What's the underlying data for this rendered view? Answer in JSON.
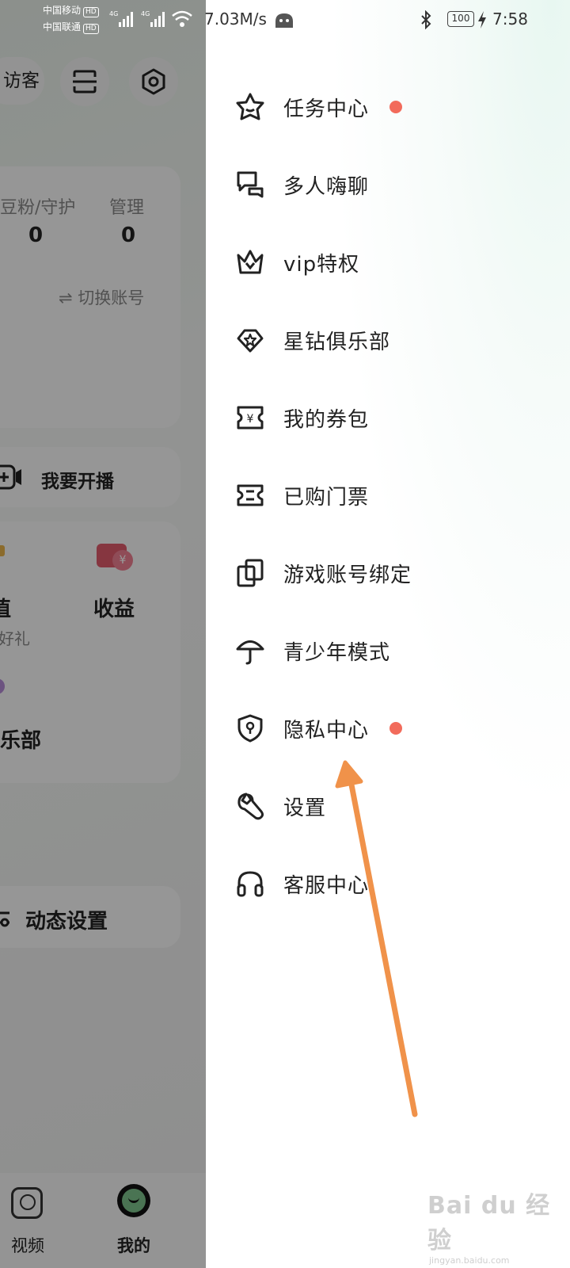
{
  "status_bar": {
    "carrier1": "中国移动",
    "carrier2": "中国联通",
    "hd": "HD",
    "net": "4G",
    "speed": "7.03M/s",
    "battery": "100",
    "time": "7:58"
  },
  "background_page": {
    "visitor_label": "访客",
    "stats": [
      {
        "label": "豆粉/守护",
        "value": "0"
      },
      {
        "label": "管理",
        "value": "0"
      }
    ],
    "switch_account": "⇌ 切换账号",
    "go_live": "我要开播",
    "recharge_title": "值",
    "recharge_sub": "好礼",
    "earnings": "收益",
    "club": "乐部",
    "dynamic_settings": "动态设置",
    "tabs": [
      {
        "label": "视频"
      },
      {
        "label": "我的"
      }
    ]
  },
  "drawer": {
    "items": [
      {
        "label": "任务中心",
        "icon": "star-house-icon",
        "dot": true
      },
      {
        "label": "多人嗨聊",
        "icon": "chat-bubbles-icon",
        "dot": false
      },
      {
        "label": "vip特权",
        "icon": "crown-icon",
        "dot": false
      },
      {
        "label": "星钻俱乐部",
        "icon": "diamond-star-icon",
        "dot": false
      },
      {
        "label": "我的券包",
        "icon": "coupon-icon",
        "dot": false
      },
      {
        "label": "已购门票",
        "icon": "ticket-icon",
        "dot": false
      },
      {
        "label": "游戏账号绑定",
        "icon": "link-squares-icon",
        "dot": false
      },
      {
        "label": "青少年模式",
        "icon": "umbrella-icon",
        "dot": false
      },
      {
        "label": "隐私中心",
        "icon": "shield-lock-icon",
        "dot": true
      },
      {
        "label": "设置",
        "icon": "wrench-icon",
        "dot": false
      },
      {
        "label": "客服中心",
        "icon": "headset-icon",
        "dot": false
      }
    ]
  },
  "annotation": {
    "arrow_color": "#f0924a",
    "dot_color": "#f26b5b"
  },
  "watermark": {
    "main": "Bai du 经验",
    "sub": "jingyan.baidu.com"
  }
}
